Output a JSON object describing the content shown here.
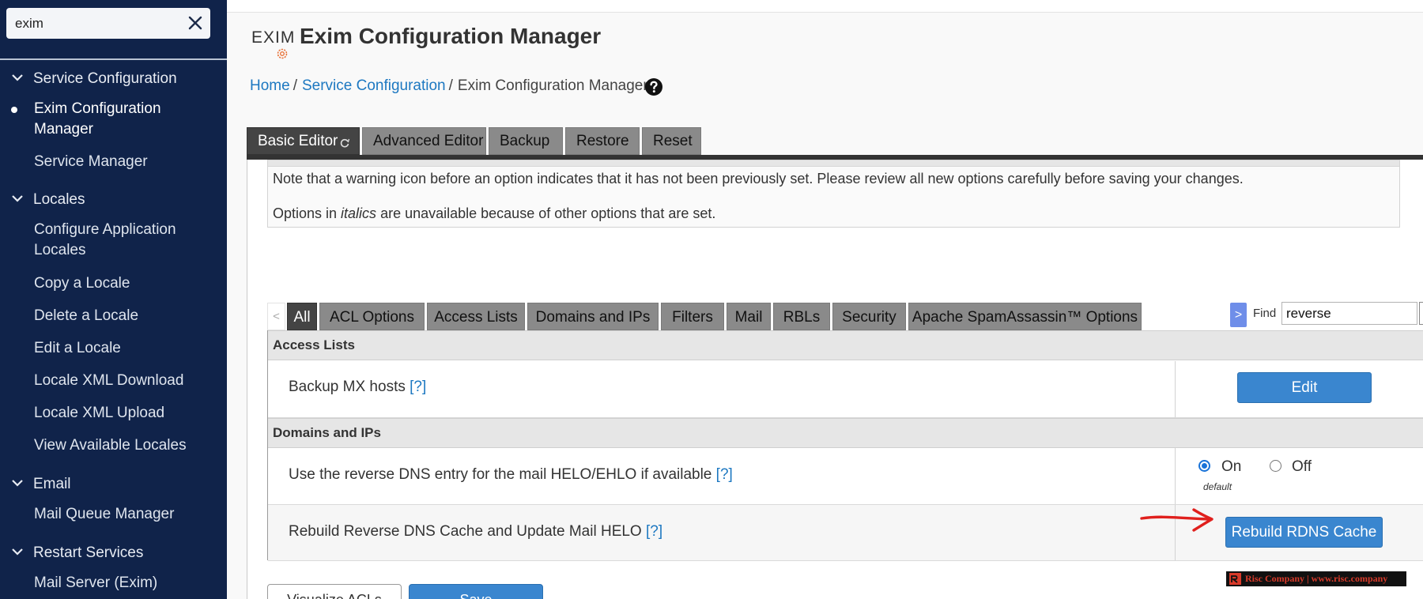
{
  "search": {
    "value": "exim"
  },
  "sidebar": {
    "categories": [
      {
        "label": "Service Configuration"
      },
      {
        "label": "Locales"
      },
      {
        "label": "Email"
      },
      {
        "label": "Restart Services"
      }
    ],
    "items": [
      {
        "label": "Exim Configuration Manager",
        "active": true
      },
      {
        "label": "Service Manager"
      },
      {
        "label": "Configure Application Locales"
      },
      {
        "label": "Copy a Locale"
      },
      {
        "label": "Delete a Locale"
      },
      {
        "label": "Edit a Locale"
      },
      {
        "label": "Locale XML Download"
      },
      {
        "label": "Locale XML Upload"
      },
      {
        "label": "View Available Locales"
      },
      {
        "label": "Mail Queue Manager"
      },
      {
        "label": "Mail Server (Exim)"
      }
    ]
  },
  "header": {
    "logo_text": "EXIM",
    "title": "Exim Configuration Manager"
  },
  "breadcrumb": {
    "home": "Home",
    "sep": "/",
    "section": "Service Configuration",
    "current": "Exim Configuration Manager"
  },
  "editor_tabs": [
    "Basic Editor",
    "Advanced Editor",
    "Backup",
    "Restore",
    "Reset"
  ],
  "notice": {
    "line1": "Note that a warning icon before an option indicates that it has not been previously set. Please review all new options carefully before saving your changes.",
    "line2_prefix": "Options in ",
    "line2_italic": "italics",
    "line2_suffix": " are unavailable because of other options that are set."
  },
  "filter": {
    "prev": "<",
    "tabs": [
      "All",
      "ACL Options",
      "Access Lists",
      "Domains and IPs",
      "Filters",
      "Mail",
      "RBLs",
      "Security",
      "Apache SpamAssassin™ Options"
    ],
    "active": "All",
    "find_toggle": ">",
    "find_label": "Find",
    "find_value": "reverse"
  },
  "sections": [
    {
      "title": "Access Lists",
      "rows": [
        {
          "label": "Backup MX hosts",
          "help": "[?]",
          "button": "Edit"
        }
      ]
    },
    {
      "title": "Domains and IPs",
      "rows": [
        {
          "label": "Use the reverse DNS entry for the mail HELO/EHLO if available",
          "help": "[?]",
          "radio_on": "On",
          "radio_off": "Off",
          "selected": "On",
          "default_note": "default"
        },
        {
          "label": "Rebuild Reverse DNS Cache and Update Mail HELO",
          "help": "[?]",
          "button": "Rebuild RDNS Cache"
        }
      ]
    }
  ],
  "footer": {
    "visualize": "Visualize ACLs",
    "save": "Save"
  },
  "watermark": "Risc Company | www.risc.company",
  "colors": {
    "sidebar": "#10234a",
    "link": "#1d78c1",
    "primary_button": "#3a86cf",
    "annotation_arrow": "#e0201d"
  }
}
